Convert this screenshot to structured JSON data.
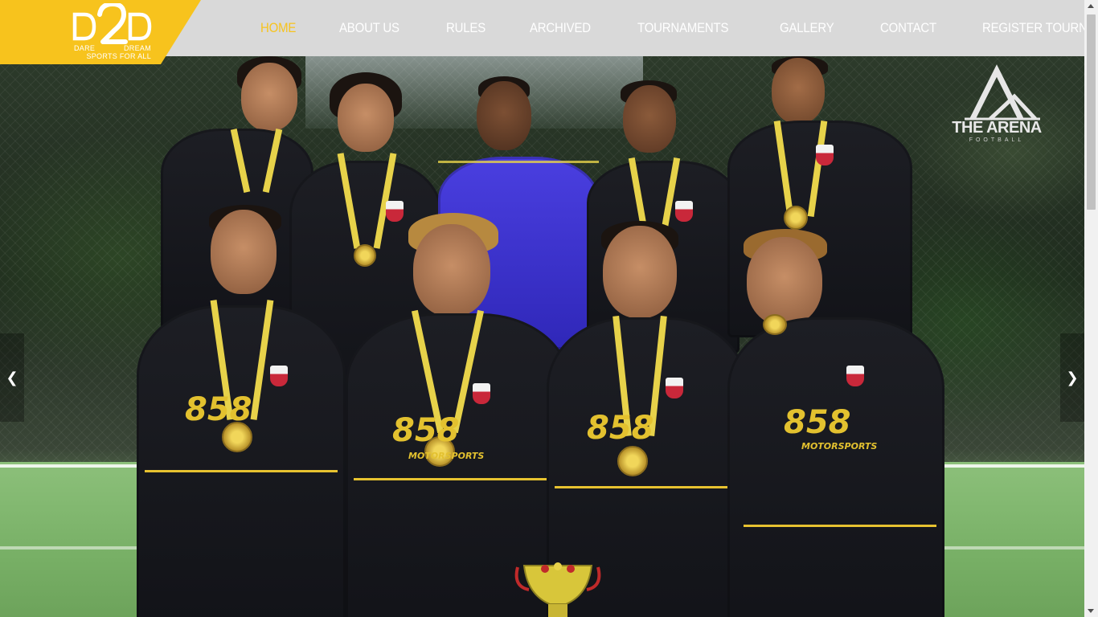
{
  "logo": {
    "mark": "D2D",
    "word_left": "DARE",
    "word_right": "DREAM",
    "tagline": "SPORTS FOR ALL",
    "bg_color": "#f7c31d"
  },
  "nav": {
    "items": [
      {
        "label": "HOME",
        "active": true
      },
      {
        "label": "ABOUT US",
        "active": false
      },
      {
        "label": "RULES",
        "active": false
      },
      {
        "label": "ARCHIVED",
        "active": false
      },
      {
        "label": "TOURNAMENTS",
        "active": false
      },
      {
        "label": "GALLERY",
        "active": false
      },
      {
        "label": "CONTACT",
        "active": false
      },
      {
        "label": "REGISTER TOURNAMENT",
        "active": false
      }
    ],
    "active_color": "#f7c31d"
  },
  "hero": {
    "watermark_title": "THE ARENA",
    "watermark_sub": "FOOTBALL",
    "jersey_sponsor": "858",
    "jersey_sponsor_sub": "MOTORSPORTS",
    "prev_icon": "chevron-left-icon",
    "next_icon": "chevron-right-icon",
    "prev_glyph": "❮",
    "next_glyph": "❯"
  }
}
